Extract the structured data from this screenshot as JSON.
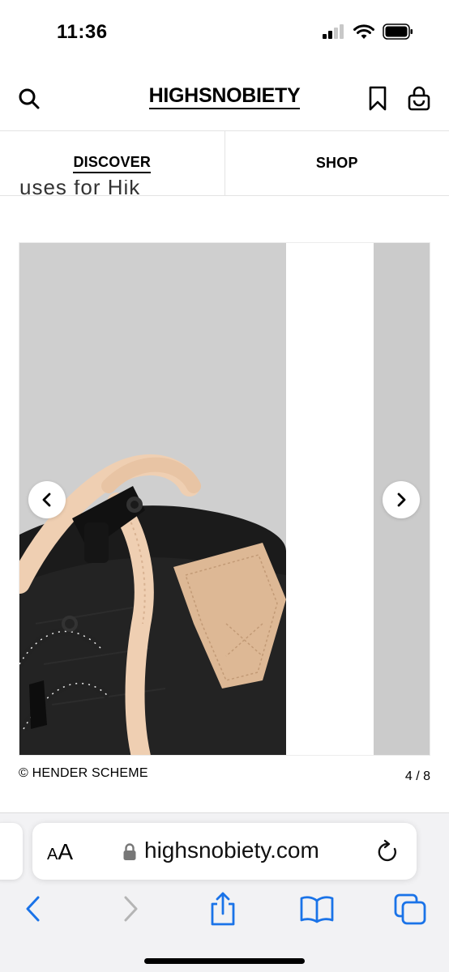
{
  "status_bar": {
    "time": "11:36"
  },
  "header": {
    "brand": "HIGHSNOBIETY",
    "icons": [
      "search-icon",
      "bookmark-icon",
      "shopping-bag-icon"
    ]
  },
  "tabs": [
    {
      "label": "DISCOVER",
      "active": true
    },
    {
      "label": "SHOP",
      "active": false
    }
  ],
  "article": {
    "partial_text": "uses for Hik"
  },
  "gallery": {
    "caption": "© HENDER SCHEME",
    "counter": "4 / 8",
    "current": 4,
    "total": 8
  },
  "browser": {
    "text_size_label_small": "A",
    "text_size_label_large": "A",
    "url": "highsnobiety.com",
    "toolbar_icons": [
      "back-icon",
      "forward-icon",
      "share-icon",
      "bookmarks-icon",
      "tabs-icon"
    ]
  },
  "colors": {
    "accent_blue": "#1a73e8",
    "disabled_gray": "#b5b5b5",
    "divider": "#e3e3e3"
  }
}
